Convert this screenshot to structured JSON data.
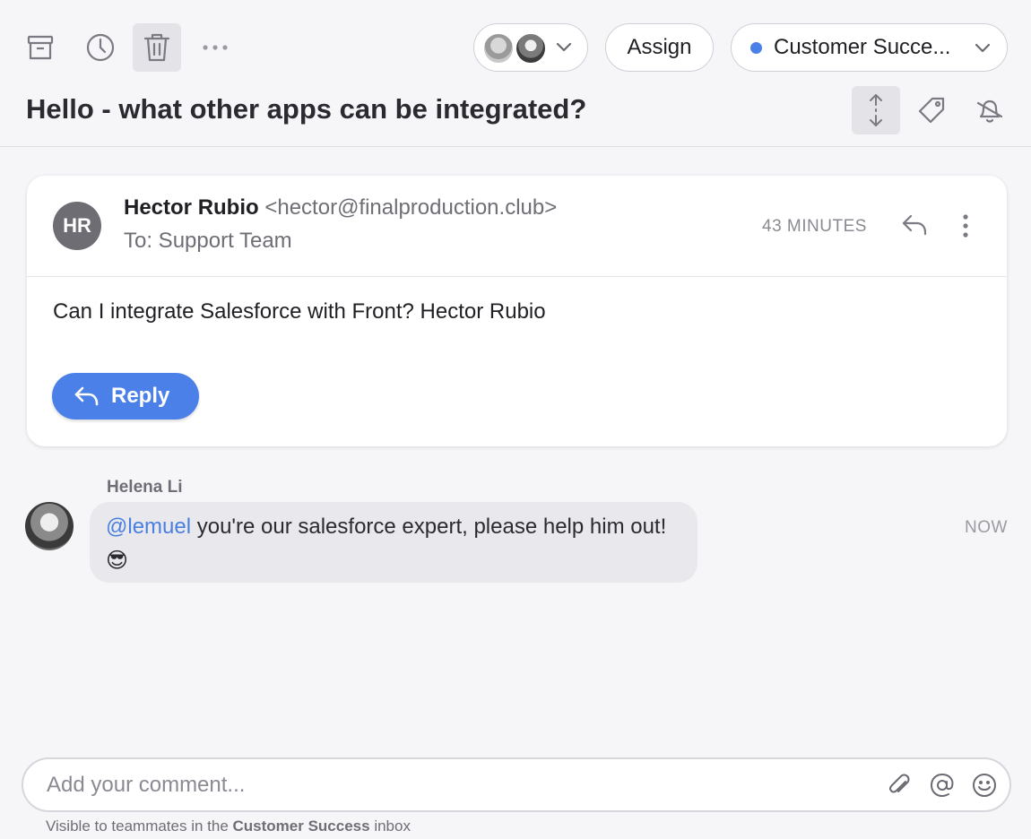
{
  "toolbar": {
    "archive_icon": "archive-icon",
    "snooze_icon": "clock-icon",
    "delete_icon": "trash-icon",
    "more_icon": "more-horizontal-icon",
    "assign_label": "Assign",
    "inbox_label": "Customer Succe...",
    "inbox_dot_color": "#4a80e8"
  },
  "conversation": {
    "title": "Hello - what other apps can be integrated?"
  },
  "message": {
    "avatar_initials": "HR",
    "sender_name": "Hector Rubio",
    "sender_email": "<hector@finalproduction.club>",
    "recipient": "To: Support Team",
    "time": "43 MINUTES",
    "body": "Can I integrate Salesforce with Front? Hector Rubio",
    "reply_label": "Reply"
  },
  "comment": {
    "author": "Helena Li",
    "mention": "@lemuel",
    "text": " you're our salesforce expert, please help him out! ",
    "emoji": "😎",
    "time": "NOW"
  },
  "composer": {
    "placeholder": "Add your comment...",
    "note_prefix": "Visible to teammates in the ",
    "note_inbox": "Customer Success",
    "note_suffix": " inbox"
  },
  "colors": {
    "accent": "#4a80e8",
    "background": "#f6f6f9"
  }
}
